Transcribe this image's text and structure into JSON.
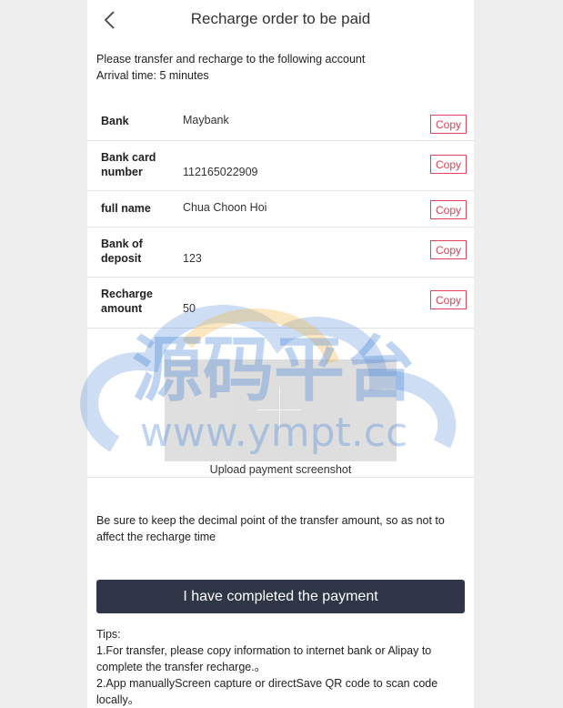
{
  "header": {
    "title": "Recharge order to be paid"
  },
  "intro": {
    "line1": "Please transfer and recharge to the following account",
    "line2": "Arrival time: 5 minutes"
  },
  "rows": [
    {
      "label": "Bank",
      "value": "Maybank",
      "copy": "Copy"
    },
    {
      "label": "Bank card number",
      "value": "112165022909",
      "copy": "Copy"
    },
    {
      "label": "full name",
      "value": "Chua Choon Hoi",
      "copy": "Copy"
    },
    {
      "label": "Bank of deposit",
      "value": "123",
      "copy": "Copy"
    },
    {
      "label": "Recharge amount",
      "value": "50",
      "copy": "Copy"
    }
  ],
  "upload": {
    "label": "Upload payment screenshot"
  },
  "notice": "Be sure to keep the decimal point of the transfer amount, so as not to affect the recharge time",
  "pay_button": "I have completed the payment",
  "tips": {
    "title": "Tips:",
    "line1": "1.For transfer, please copy information to internet bank or Alipay to complete the transfer recharge.。",
    "line2": "2.App manuallyScreen capture or directSave QR code to scan code locally。"
  },
  "watermark": {
    "cn": "源码平台",
    "url": "www.ympt.cc"
  },
  "colors": {
    "accent": "#d94055",
    "button_bg": "#2f3647",
    "watermark_blue": "#4a86d8",
    "watermark_orange": "#f2b84a"
  },
  "icons": {
    "back": "chevron-left-icon"
  }
}
